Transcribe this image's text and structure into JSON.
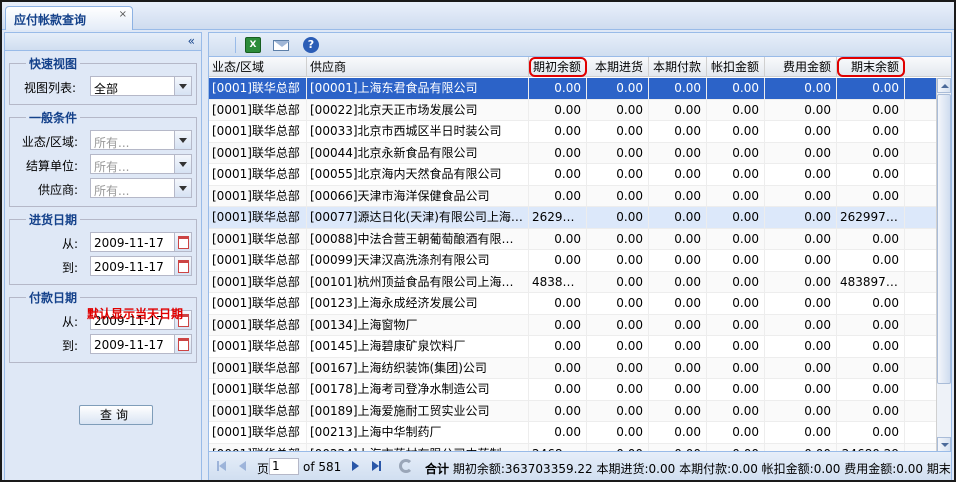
{
  "tab": {
    "title": "应付帐款查询",
    "close": "×"
  },
  "left": {
    "collapse": "«",
    "quick": {
      "legend": "快速视图",
      "view_label": "视图列表:",
      "view_value": "全部"
    },
    "general": {
      "legend": "一般条件",
      "region_label": "业态/区域:",
      "region_placeholder": "所有...",
      "settle_label": "结算单位:",
      "settle_placeholder": "所有...",
      "supplier_label": "供应商:",
      "supplier_placeholder": "所有..."
    },
    "purchase_date": {
      "legend": "进货日期",
      "from_label": "从:",
      "from_value": "2009-11-17",
      "to_label": "到:",
      "to_value": "2009-11-17"
    },
    "payment_date": {
      "legend": "付款日期",
      "from_label": "从:",
      "from_value": "2009-11-17",
      "to_label": "到:",
      "to_value": "2009-11-17"
    },
    "warning": "默认显示当天日期",
    "query_button": "查询"
  },
  "toolbar": {
    "excel": "X",
    "help": "?"
  },
  "grid": {
    "columns": [
      "业态/区域",
      "供应商",
      "期初余额",
      "本期进货",
      "本期付款",
      "帐扣金额",
      "费用金额",
      "期末余额"
    ],
    "rows": [
      [
        "[0001]联华总部",
        "[00001]上海东君食品有限公司",
        "0.00",
        "0.00",
        "0.00",
        "0.00",
        "0.00",
        "0.00"
      ],
      [
        "[0001]联华总部",
        "[00022]北京天正市场发展公司",
        "0.00",
        "0.00",
        "0.00",
        "0.00",
        "0.00",
        "0.00"
      ],
      [
        "[0001]联华总部",
        "[00033]北京市西城区半日时装公司",
        "0.00",
        "0.00",
        "0.00",
        "0.00",
        "0.00",
        "0.00"
      ],
      [
        "[0001]联华总部",
        "[00044]北京永新食品有限公司",
        "0.00",
        "0.00",
        "0.00",
        "0.00",
        "0.00",
        "0.00"
      ],
      [
        "[0001]联华总部",
        "[00055]北京海内天然食品有限公司",
        "0.00",
        "0.00",
        "0.00",
        "0.00",
        "0.00",
        "0.00"
      ],
      [
        "[0001]联华总部",
        "[00066]天津市海洋保健食品公司",
        "0.00",
        "0.00",
        "0.00",
        "0.00",
        "0.00",
        "0.00"
      ],
      [
        "[0001]联华总部",
        "[00077]源达日化(天津)有限公司上海分...",
        "262997...",
        "0.00",
        "0.00",
        "0.00",
        "0.00",
        "262997.79"
      ],
      [
        "[0001]联华总部",
        "[00088]中法合营王朝葡萄酿酒有限公司...",
        "0.00",
        "0.00",
        "0.00",
        "0.00",
        "0.00",
        "0.00"
      ],
      [
        "[0001]联华总部",
        "[00099]天津汉高洗涤剂有限公司",
        "0.00",
        "0.00",
        "0.00",
        "0.00",
        "0.00",
        "0.00"
      ],
      [
        "[0001]联华总部",
        "[00101]杭州顶益食品有限公司上海分公...",
        "483897...",
        "0.00",
        "0.00",
        "0.00",
        "0.00",
        "4838976..."
      ],
      [
        "[0001]联华总部",
        "[00123]上海永成经济发展公司",
        "0.00",
        "0.00",
        "0.00",
        "0.00",
        "0.00",
        "0.00"
      ],
      [
        "[0001]联华总部",
        "[00134]上海窗物厂",
        "0.00",
        "0.00",
        "0.00",
        "0.00",
        "0.00",
        "0.00"
      ],
      [
        "[0001]联华总部",
        "[00145]上海碧康矿泉饮料厂",
        "0.00",
        "0.00",
        "0.00",
        "0.00",
        "0.00",
        "0.00"
      ],
      [
        "[0001]联华总部",
        "[00167]上海纺织装饰(集团)公司",
        "0.00",
        "0.00",
        "0.00",
        "0.00",
        "0.00",
        "0.00"
      ],
      [
        "[0001]联华总部",
        "[00178]上海考司登净水制造公司",
        "0.00",
        "0.00",
        "0.00",
        "0.00",
        "0.00",
        "0.00"
      ],
      [
        "[0001]联华总部",
        "[00189]上海爱施耐工贸实业公司",
        "0.00",
        "0.00",
        "0.00",
        "0.00",
        "0.00",
        "0.00"
      ],
      [
        "[0001]联华总部",
        "[00213]上海中华制药厂",
        "0.00",
        "0.00",
        "0.00",
        "0.00",
        "0.00",
        "0.00"
      ],
      [
        "[0001]联华总部",
        "[00224]上海市药材有限公司中药制药一...",
        "24680.29",
        "0.00",
        "0.00",
        "0.00",
        "0.00",
        "24680.29"
      ]
    ],
    "selected_row": 0,
    "hover_row": 6
  },
  "pager": {
    "page_label": "页",
    "page_value": "1",
    "of_label": "of 581",
    "total_label": "合计",
    "summary": "期初余额:363703359.22  本期进货:0.00  本期付款:0.00  帐扣金额:0.00  费用金额:0.00  期末"
  }
}
